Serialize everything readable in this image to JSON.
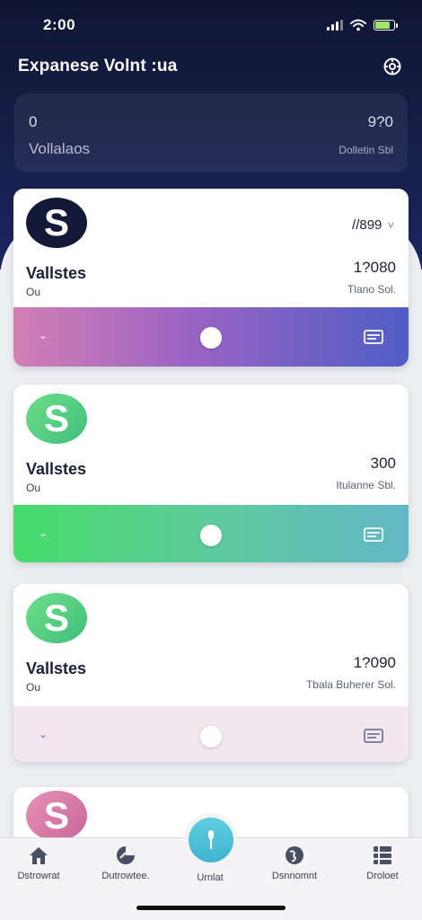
{
  "status_bar": {
    "time": "2:00"
  },
  "header": {
    "title": "Expanese Volnt :ua",
    "settings_icon": "settings-gear-icon"
  },
  "summary": {
    "count": "0",
    "amount": "9?0",
    "label": "Vollalaos",
    "sub_label": "Dolletin Sbl"
  },
  "wallets": [
    {
      "name": "Vallstes",
      "sub": "Ou",
      "amount": "1?080",
      "caption": "Tlano Sol.",
      "chip": "//899",
      "chip_icon": "˅",
      "avatar_letter": "S",
      "bar_gradient": [
        "#d27fb4",
        "#4f5ec5"
      ]
    },
    {
      "name": "Vallstes",
      "sub": "Ou",
      "amount": "300",
      "caption": "Itulanne Sbl.",
      "avatar_letter": "S",
      "bar_gradient": [
        "#45dc6a",
        "#62b7c6"
      ]
    },
    {
      "name": "Vallstes",
      "sub": "Ou",
      "amount": "1?090",
      "caption": "Tbala Buherer Sol.",
      "avatar_letter": "S",
      "bar_color": "#f3e6ef"
    }
  ],
  "peek_card": {
    "avatar_letter": "S"
  },
  "bottom_nav": [
    {
      "label": "Dstrowrat",
      "icon": "home-icon"
    },
    {
      "label": "Dutrowtee.",
      "icon": "chart-icon"
    },
    {
      "label": "Urnlat",
      "icon": "microphone-icon"
    },
    {
      "label": "Dsnnomnt",
      "icon": "globe-icon"
    },
    {
      "label": "Droloet",
      "icon": "list-icon"
    }
  ]
}
